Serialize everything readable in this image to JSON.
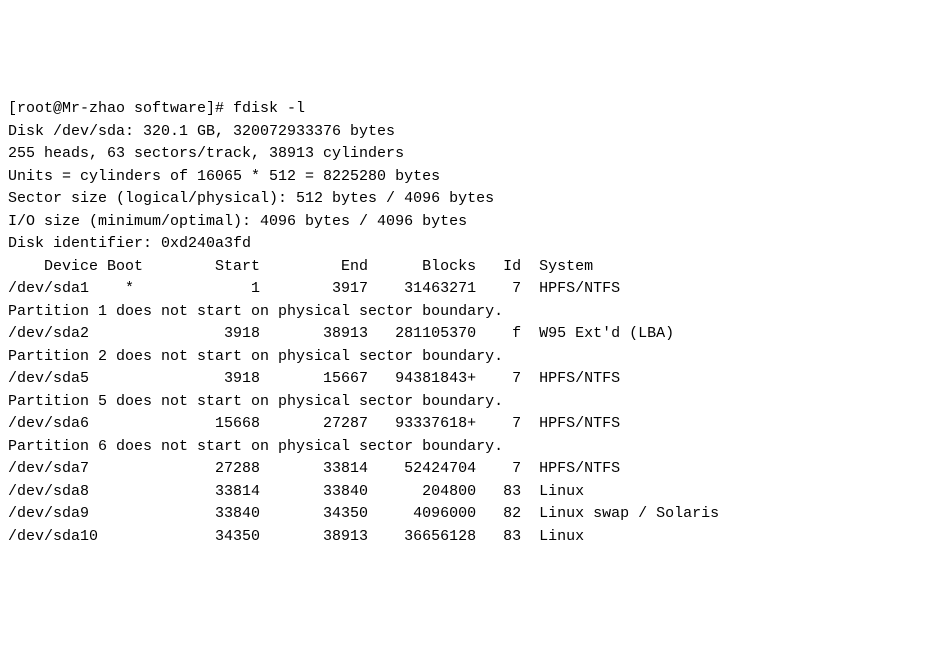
{
  "prompt": {
    "user": "root",
    "host": "Mr-zhao",
    "cwd": "software",
    "symbol": "#",
    "command": "fdisk -l"
  },
  "disk": {
    "path": "/dev/sda",
    "size_gb": "320.1",
    "bytes": "320072933376",
    "heads": "255",
    "sectors_per_track": "63",
    "cylinders": "38913",
    "cyl_mult": "16065",
    "cyl_mult2": "512",
    "cyl_bytes": "8225280",
    "logical_sector": "512",
    "physical_sector": "4096",
    "io_min": "4096",
    "io_opt": "4096",
    "identifier": "0xd240a3fd"
  },
  "header": {
    "device": "Device",
    "boot": "Boot",
    "start": "Start",
    "end": "End",
    "blocks": "Blocks",
    "id": "Id",
    "system": "System"
  },
  "rows": [
    {
      "device": "/dev/sda1",
      "boot": "*",
      "start": "1",
      "end": "3917",
      "blocks": "31463271",
      "id": "7",
      "system": "HPFS/NTFS"
    },
    {
      "device": "/dev/sda2",
      "boot": "",
      "start": "3918",
      "end": "38913",
      "blocks": "281105370",
      "id": "f",
      "system": "W95 Ext'd (LBA)"
    },
    {
      "device": "/dev/sda5",
      "boot": "",
      "start": "3918",
      "end": "15667",
      "blocks": "94381843+",
      "id": "7",
      "system": "HPFS/NTFS"
    },
    {
      "device": "/dev/sda6",
      "boot": "",
      "start": "15668",
      "end": "27287",
      "blocks": "93337618+",
      "id": "7",
      "system": "HPFS/NTFS"
    },
    {
      "device": "/dev/sda7",
      "boot": "",
      "start": "27288",
      "end": "33814",
      "blocks": "52424704",
      "id": "7",
      "system": "HPFS/NTFS"
    },
    {
      "device": "/dev/sda8",
      "boot": "",
      "start": "33814",
      "end": "33840",
      "blocks": "204800",
      "id": "83",
      "system": "Linux"
    },
    {
      "device": "/dev/sda9",
      "boot": "",
      "start": "33840",
      "end": "34350",
      "blocks": "4096000",
      "id": "82",
      "system": "Linux swap / Solaris"
    },
    {
      "device": "/dev/sda10",
      "boot": "",
      "start": "34350",
      "end": "38913",
      "blocks": "36656128",
      "id": "83",
      "system": "Linux"
    }
  ],
  "warnings": {
    "1": "Partition 1 does not start on physical sector boundary.",
    "2": "Partition 2 does not start on physical sector boundary.",
    "5": "Partition 5 does not start on physical sector boundary.",
    "6": "Partition 6 does not start on physical sector boundary."
  }
}
